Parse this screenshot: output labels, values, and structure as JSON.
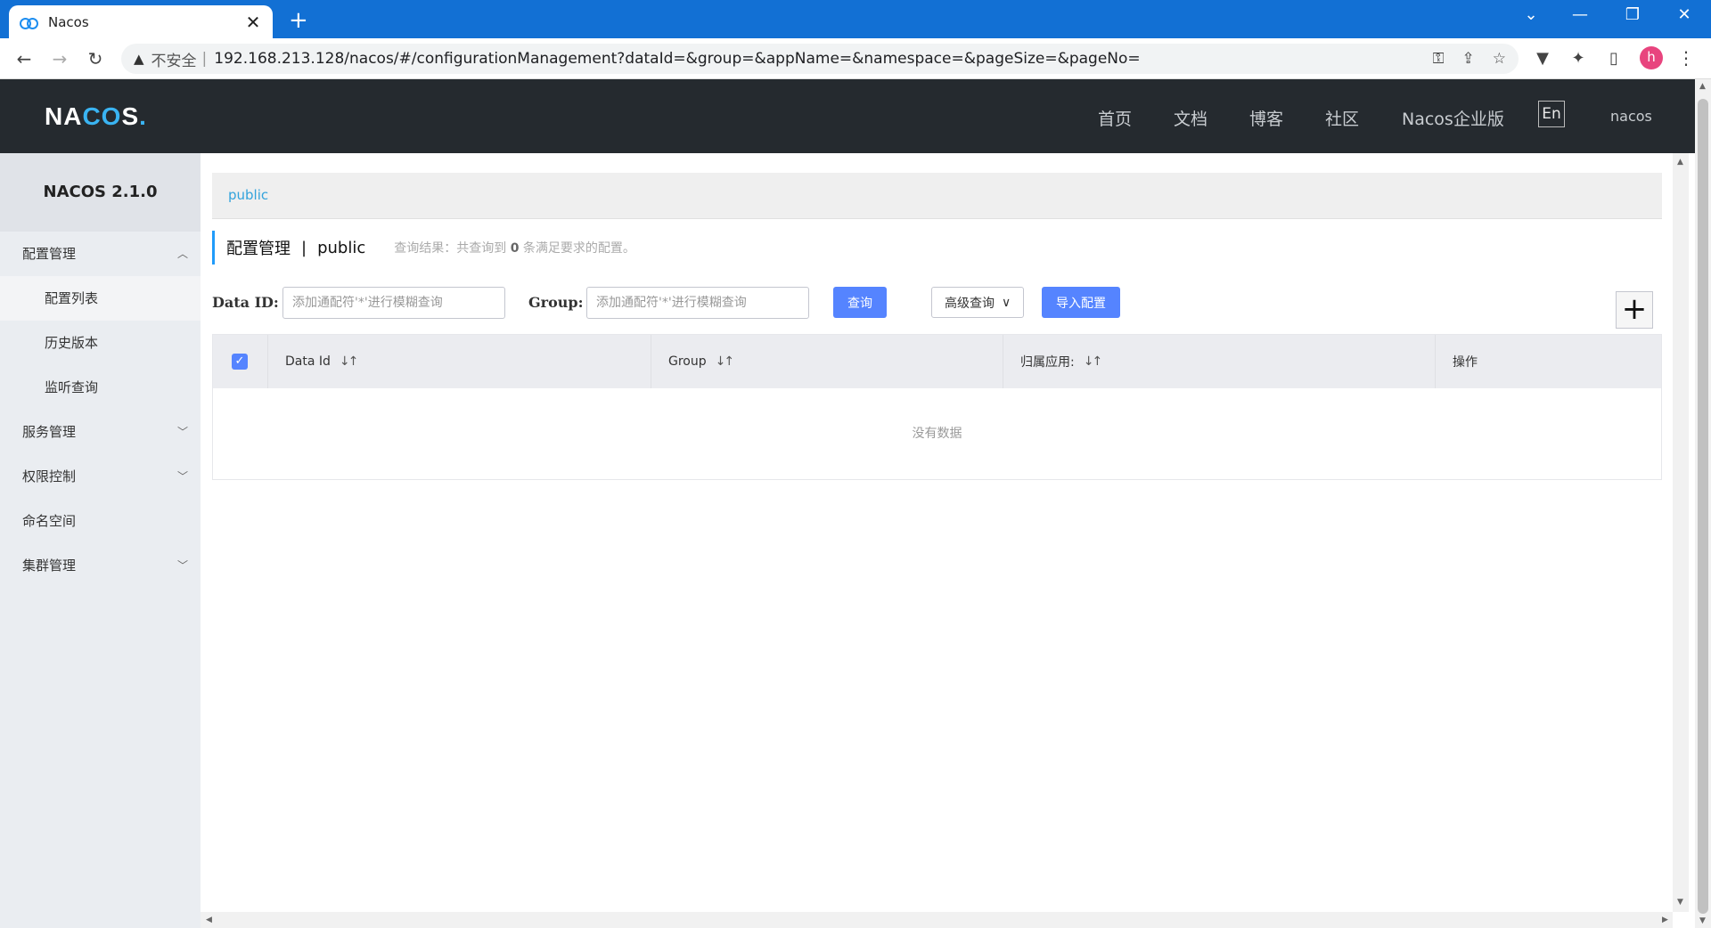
{
  "browser": {
    "tab_title": "Nacos",
    "tab_close": "✕",
    "new_tab": "+",
    "security_label": "不安全",
    "security_sep": "|",
    "url": "192.168.213.128/nacos/#/configurationManagement?dataId=&group=&appName=&namespace=&pageSize=&pageNo=",
    "profile_initial": "h"
  },
  "header": {
    "logo_prefix": "NA",
    "logo_oo": "CO",
    "logo_suffix": "S",
    "logo_dot": ".",
    "nav": [
      "首页",
      "文档",
      "博客",
      "社区",
      "Nacos企业版"
    ],
    "lang": "En",
    "user": "nacos"
  },
  "sidebar": {
    "version": "NACOS 2.1.0",
    "items": [
      {
        "label": "配置管理",
        "arrow": "^"
      },
      {
        "label": "配置列表"
      },
      {
        "label": "历史版本"
      },
      {
        "label": "监听查询"
      },
      {
        "label": "服务管理",
        "arrow": "v"
      },
      {
        "label": "权限控制",
        "arrow": "v"
      },
      {
        "label": "命名空间"
      },
      {
        "label": "集群管理",
        "arrow": "v"
      }
    ]
  },
  "main": {
    "namespace_link": "public",
    "title": "配置管理",
    "title_sep": "|",
    "namespace": "public",
    "result_prefix": "查询结果：共查询到",
    "result_count": "0",
    "result_suffix": "条满足要求的配置。"
  },
  "search": {
    "dataid_label": "Data ID:",
    "dataid_placeholder": "添加通配符'*'进行模糊查询",
    "group_label": "Group:",
    "group_placeholder": "添加通配符'*'进行模糊查询",
    "query_button": "查询",
    "advanced_button": "高级查询",
    "import_button": "导入配置",
    "add_button": "+"
  },
  "table": {
    "columns": [
      "Data Id",
      "Group",
      "归属应用:",
      "操作"
    ],
    "empty_text": "没有数据"
  }
}
